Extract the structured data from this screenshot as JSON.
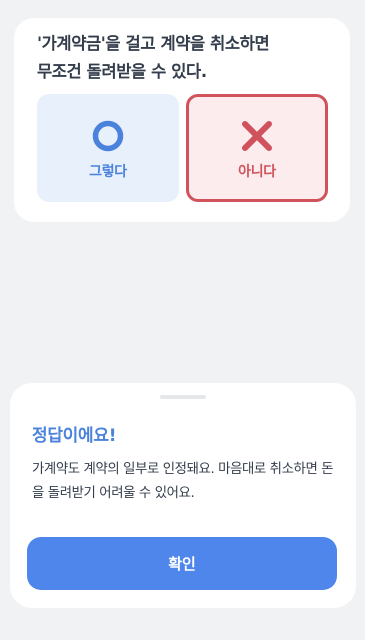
{
  "quiz": {
    "question": "'가계약금'을 걸고 계약을 취소하면\n무조건 돌려받을 수 있다.",
    "options": [
      {
        "label": "그렇다",
        "icon": "circle-o-icon",
        "color": "#4a82dc"
      },
      {
        "label": "아니다",
        "icon": "x-mark-icon",
        "color": "#d0525d",
        "selected": true
      }
    ]
  },
  "result": {
    "title": "정답이에요!",
    "explanation": "가계약도 계약의 일부로 인정돼요. 마음대로 취소하면 돈을 돌려받기 어려울 수 있어요.",
    "confirm_label": "확인"
  }
}
